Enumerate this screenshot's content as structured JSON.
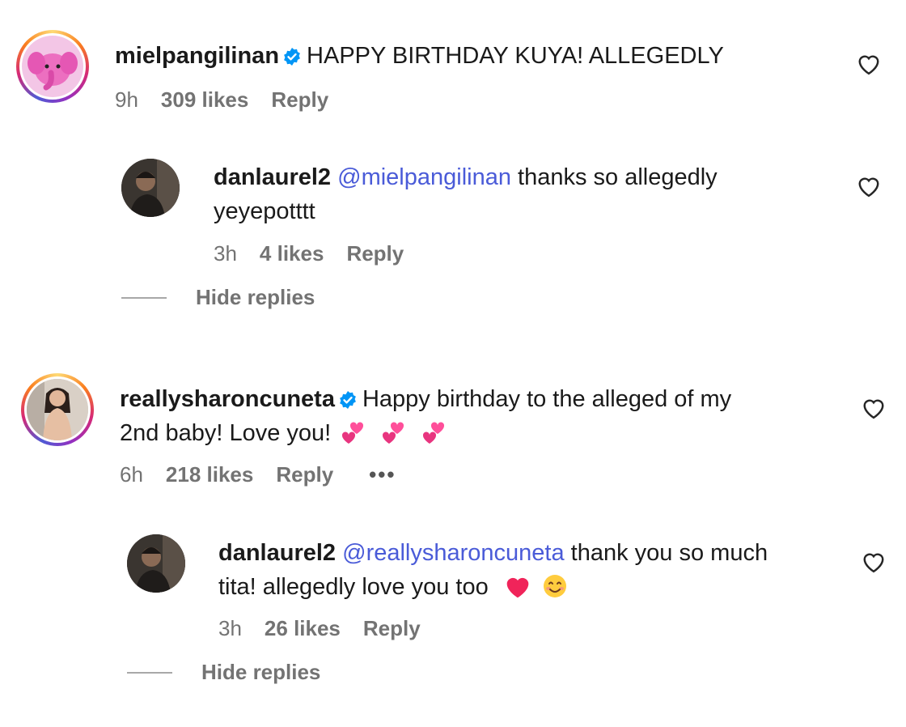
{
  "comments": [
    {
      "username": "mielpangilinan",
      "text": "HAPPY BIRTHDAY KUYA! ALLEGEDLY",
      "time": "9h",
      "likes": "309 likes",
      "reply": "Reply",
      "replies": [
        {
          "username": "danlaurel2",
          "mention": "@mielpangilinan",
          "text_line1": "thanks so allegedly",
          "text_line2": "yeyepotttt",
          "time": "3h",
          "likes": "4 likes",
          "reply": "Reply"
        }
      ],
      "hide_replies": "Hide replies"
    },
    {
      "username": "reallysharoncuneta",
      "text_line1": "Happy birthday to the alleged of my",
      "text_line2": "2nd baby! Love you!",
      "time": "6h",
      "likes": "218 likes",
      "reply": "Reply",
      "more": "•••",
      "replies": [
        {
          "username": "danlaurel2",
          "mention": "@reallysharoncuneta",
          "text_line1": "thank you so much",
          "text_line2": "tita! allegedly love you too",
          "time": "3h",
          "likes": "26 likes",
          "reply": "Reply"
        }
      ],
      "hide_replies": "Hide replies"
    }
  ],
  "icons": {
    "verified": "verified-badge-icon",
    "like": "heart-outline-icon",
    "emoji_two_hearts": "two-hearts-emoji",
    "emoji_red_heart": "red-heart-emoji",
    "emoji_smile": "smiling-face-emoji"
  },
  "colors": {
    "mention": "#4a5bd8",
    "meta": "#737373",
    "verified": "#0095f6"
  }
}
